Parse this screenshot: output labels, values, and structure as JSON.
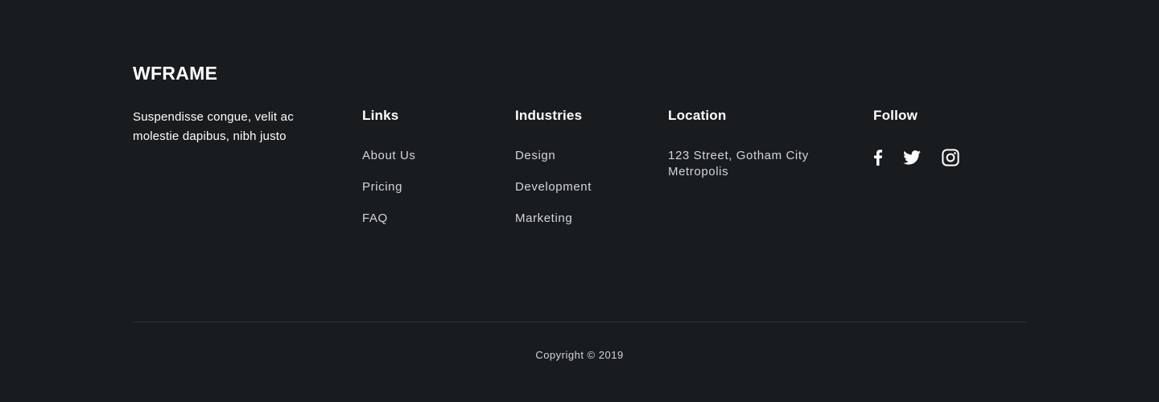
{
  "brand": {
    "name": "WFRAME",
    "tagline": "Suspendisse congue, velit ac molestie dapibus, nibh justo"
  },
  "links": {
    "heading": "Links",
    "items": [
      "About Us",
      "Pricing",
      "FAQ"
    ]
  },
  "industries": {
    "heading": "Industries",
    "items": [
      "Design",
      "Development",
      "Marketing"
    ]
  },
  "location": {
    "heading": "Location",
    "address": "123 Street, Gotham City Metropolis"
  },
  "follow": {
    "heading": "Follow",
    "icons": [
      "facebook-icon",
      "twitter-icon",
      "instagram-icon"
    ]
  },
  "footer": {
    "copyright": "Copyright © 2019"
  },
  "colors": {
    "background": "#191c1f",
    "heading": "#ffffff",
    "link": "#d3d5d8",
    "divider": "#2d3136"
  }
}
